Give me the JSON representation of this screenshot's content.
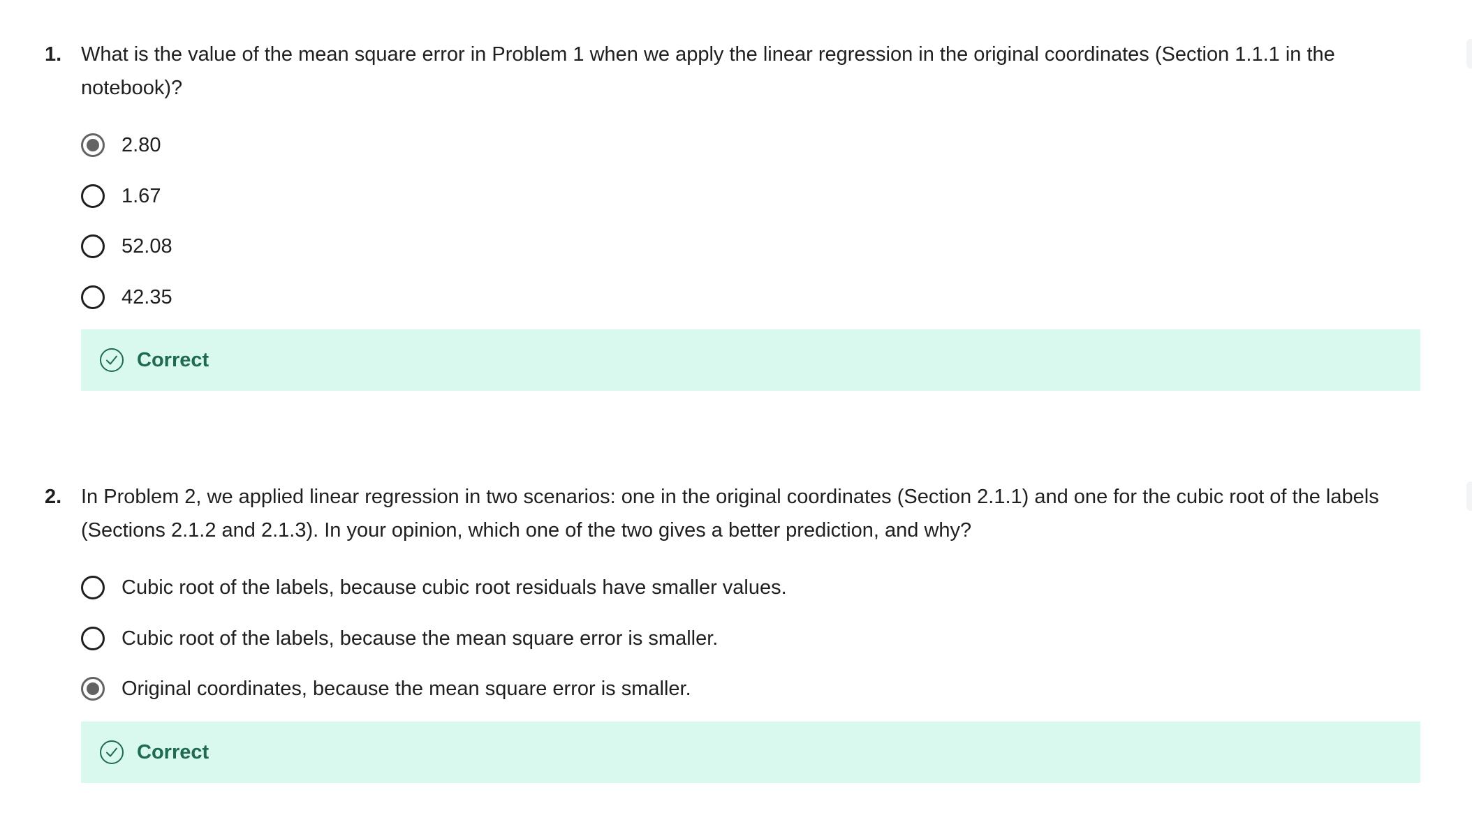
{
  "questions": [
    {
      "number": "1.",
      "text": "What is the value of the mean square error in Problem 1 when we apply the linear regression in the original coordinates (Section 1.1.1 in the notebook)?",
      "options": [
        {
          "label": "2.80",
          "selected": true
        },
        {
          "label": "1.67",
          "selected": false
        },
        {
          "label": "52.08",
          "selected": false
        },
        {
          "label": "42.35",
          "selected": false
        }
      ],
      "feedback": {
        "label": "Correct",
        "icon": "check-circle-icon"
      }
    },
    {
      "number": "2.",
      "text": "In Problem 2, we applied linear regression in two scenarios: one in the original coordinates (Section 2.1.1) and one for the cubic root of the labels (Sections 2.1.2 and 2.1.3). In your opinion, which one of the two gives a better prediction, and why?",
      "options": [
        {
          "label": "Cubic root of the labels, because cubic root residuals have smaller values.",
          "selected": false
        },
        {
          "label": "Cubic root of the labels, because the mean square error is smaller.",
          "selected": false
        },
        {
          "label": "Original coordinates, because the mean square error is smaller.",
          "selected": true
        }
      ],
      "feedback": {
        "label": "Correct",
        "icon": "check-circle-icon"
      }
    }
  ],
  "colors": {
    "feedback_background": "#d9f8ee",
    "feedback_text": "#1e6b52",
    "selected_radio": "#636363"
  }
}
